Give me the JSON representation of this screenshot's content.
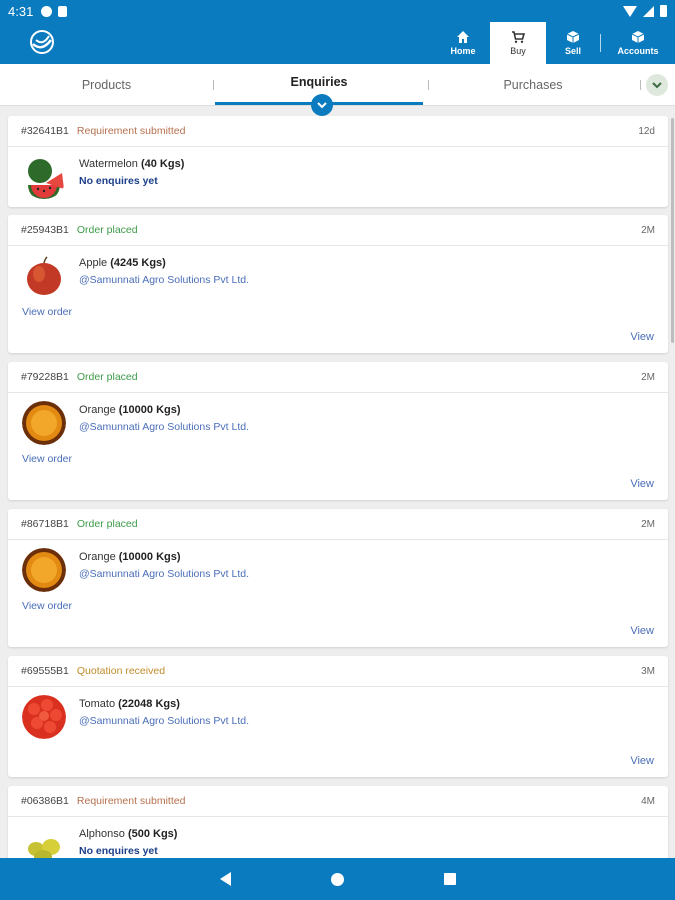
{
  "status_bar": {
    "time": "4:31"
  },
  "nav": {
    "items": [
      {
        "label": "Home",
        "icon": "home-icon"
      },
      {
        "label": "Buy",
        "icon": "cart-icon",
        "active": true
      },
      {
        "label": "Sell",
        "icon": "box-icon"
      },
      {
        "label": "Accounts",
        "icon": "box-icon"
      }
    ]
  },
  "tabs": [
    {
      "label": "Products"
    },
    {
      "label": "Enquiries",
      "active": true
    },
    {
      "label": "Purchases"
    }
  ],
  "colors": {
    "primary": "#0a7bbf",
    "placed": "#3e9b4a",
    "requirement": "#b5704e",
    "quotation": "#c18c2b",
    "link": "#4a6eb8"
  },
  "cards": [
    {
      "id": "#32641B1",
      "status": "Requirement submitted",
      "age": "12d",
      "product": "Watermelon",
      "qty": "(40 Kgs)",
      "sub": "No enquires yet",
      "fruit": "watermelon"
    },
    {
      "id": "#25943B1",
      "status": "Order placed",
      "age": "2M",
      "product": "Apple",
      "qty": "(4245 Kgs)",
      "sub": "@Samunnati Agro Solutions Pvt Ltd.",
      "view_order": "View order",
      "view": "View",
      "fruit": "apple"
    },
    {
      "id": "#79228B1",
      "status": "Order placed",
      "age": "2M",
      "product": "Orange",
      "qty": "(10000 Kgs)",
      "sub": "@Samunnati Agro Solutions Pvt Ltd.",
      "view_order": "View order",
      "view": "View",
      "fruit": "orange"
    },
    {
      "id": "#86718B1",
      "status": "Order placed",
      "age": "2M",
      "product": "Orange",
      "qty": "(10000 Kgs)",
      "sub": "@Samunnati Agro Solutions Pvt Ltd.",
      "view_order": "View order",
      "view": "View",
      "fruit": "orange"
    },
    {
      "id": "#69555B1",
      "status": "Quotation received",
      "age": "3M",
      "product": "Tomato",
      "qty": "(22048 Kgs)",
      "sub": "@Samunnati Agro Solutions Pvt Ltd.",
      "view": "View",
      "fruit": "tomato"
    },
    {
      "id": "#06386B1",
      "status": "Requirement submitted",
      "age": "4M",
      "product": "Alphonso",
      "qty": "(500 Kgs)",
      "sub": "No enquires yet",
      "fruit": "mango"
    }
  ]
}
